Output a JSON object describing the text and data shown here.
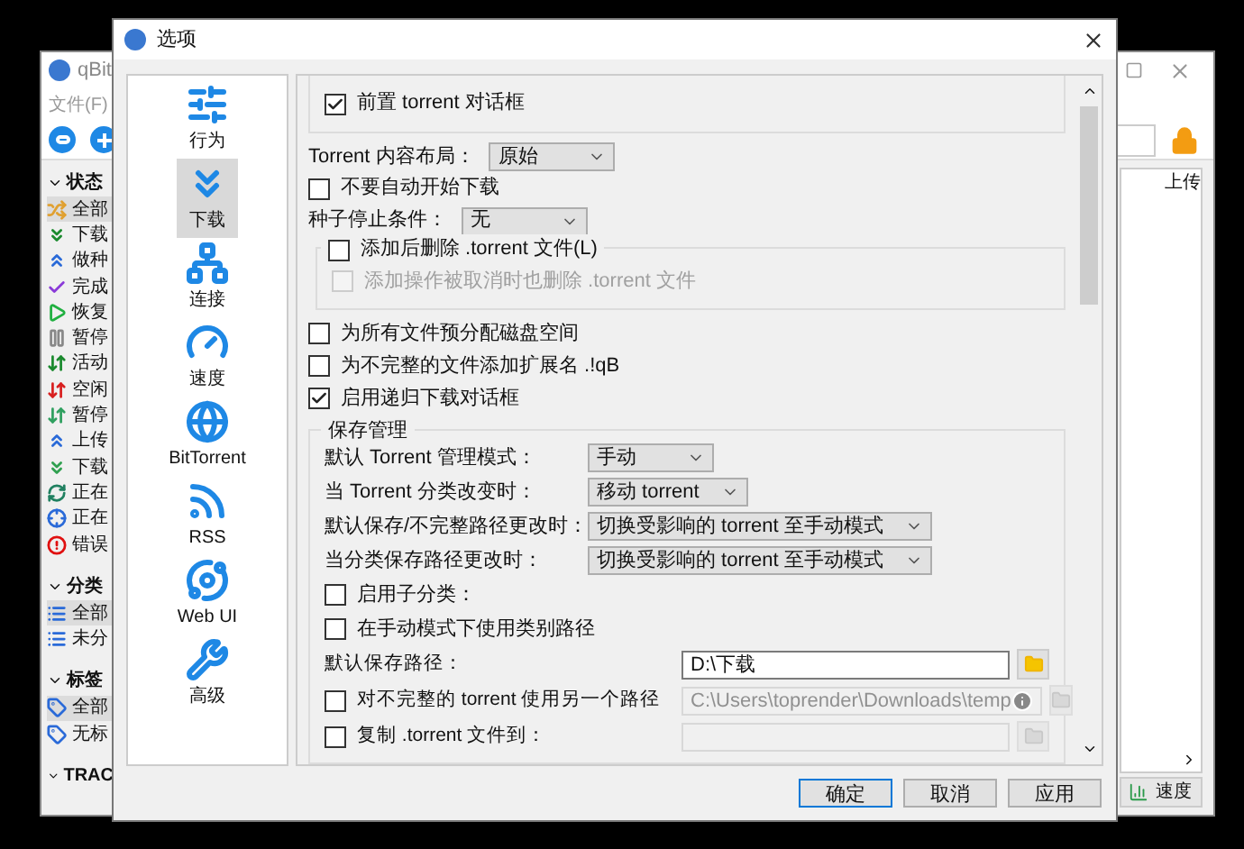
{
  "background_window": {
    "title": "qBit",
    "menu": [
      "文件(F)"
    ],
    "sections": [
      {
        "title": "状态",
        "expanded": true,
        "items": [
          {
            "label": "全部",
            "selected": true
          },
          {
            "label": "下载",
            "selected": false
          },
          {
            "label": "做种",
            "selected": false
          },
          {
            "label": "完成",
            "selected": false
          },
          {
            "label": "恢复",
            "selected": false
          },
          {
            "label": "暂停",
            "selected": false
          },
          {
            "label": "活动",
            "selected": false
          },
          {
            "label": "空闲",
            "selected": false
          },
          {
            "label": "暂停",
            "selected": false
          },
          {
            "label": "上传",
            "selected": false
          },
          {
            "label": "下载",
            "selected": false
          },
          {
            "label": "正在",
            "selected": false
          },
          {
            "label": "正在",
            "selected": false
          },
          {
            "label": "错误",
            "selected": false
          }
        ]
      },
      {
        "title": "分类",
        "expanded": true,
        "items": [
          {
            "label": "全部",
            "selected": true
          },
          {
            "label": "未分",
            "selected": false
          }
        ]
      },
      {
        "title": "标签",
        "expanded": true,
        "items": [
          {
            "label": "全部",
            "selected": true
          },
          {
            "label": "无标",
            "selected": false
          }
        ]
      },
      {
        "title": "TRAC",
        "expanded": true
      }
    ],
    "column_header": "上传",
    "speed_button": "速度"
  },
  "dialog": {
    "title": "选项",
    "categories": [
      {
        "label": "行为",
        "selected": false
      },
      {
        "label": "下载",
        "selected": true
      },
      {
        "label": "连接",
        "selected": false
      },
      {
        "label": "速度",
        "selected": false
      },
      {
        "label": "BitTorrent",
        "selected": false
      },
      {
        "label": "RSS",
        "selected": false
      },
      {
        "label": "Web UI",
        "selected": false
      },
      {
        "label": "高级",
        "selected": false
      }
    ],
    "settings": [
      {
        "kind": "group",
        "children": [
          {
            "kind": "checkbox",
            "label": "前置 torrent 对话框",
            "checked": true,
            "disabled": false
          }
        ]
      },
      {
        "kind": "combo",
        "label": "Torrent 内容布局：",
        "value": "原始"
      },
      {
        "kind": "checkbox",
        "label": "不要自动开始下载",
        "checked": false,
        "disabled": false
      },
      {
        "kind": "combo",
        "label": "种子停止条件：",
        "value": "无"
      },
      {
        "kind": "checkgroup",
        "label": "添加后删除 .torrent 文件(L)",
        "checked": false,
        "children": [
          {
            "kind": "checkbox",
            "label": "添加操作被取消时也删除 .torrent 文件",
            "checked": false,
            "disabled": true
          }
        ]
      },
      {
        "kind": "checkbox",
        "label": "为所有文件预分配磁盘空间",
        "checked": false,
        "disabled": false
      },
      {
        "kind": "checkbox",
        "label": "为不完整的文件添加扩展名 .!qB",
        "checked": false,
        "disabled": false
      },
      {
        "kind": "checkbox",
        "label": "启用递归下载对话框",
        "checked": true,
        "disabled": false
      },
      {
        "kind": "group",
        "title": "保存管理",
        "children": [
          {
            "kind": "combo",
            "label": "默认 Torrent 管理模式：",
            "value": "手动"
          },
          {
            "kind": "combo",
            "label": "当 Torrent 分类改变时：",
            "value": "移动 torrent"
          },
          {
            "kind": "combo",
            "label": "默认保存/不完整路径更改时：",
            "value": "切换受影响的 torrent 至手动模式"
          },
          {
            "kind": "combo",
            "label": "当分类保存路径更改时：",
            "value": "切换受影响的 torrent 至手动模式"
          },
          {
            "kind": "checkbox",
            "label": "启用子分类：",
            "checked": false,
            "disabled": false
          },
          {
            "kind": "checkbox",
            "label": "在手动模式下使用类别路径",
            "checked": false,
            "disabled": false
          },
          {
            "kind": "path",
            "label": "默认保存路径：",
            "value": "D:\\下载",
            "disabled": false
          },
          {
            "kind": "path",
            "label": "对不完整的 torrent 使用另一个路径",
            "checked": false,
            "value": "C:\\Users\\toprender\\Downloads\\temp",
            "disabled": true,
            "info": true
          },
          {
            "kind": "path",
            "label": "复制 .torrent 文件到：",
            "checked": false,
            "disabled": true
          }
        ]
      }
    ],
    "buttons": [
      {
        "label": "确定",
        "default": true
      },
      {
        "label": "取消",
        "default": false
      },
      {
        "label": "应用",
        "default": false
      }
    ]
  }
}
